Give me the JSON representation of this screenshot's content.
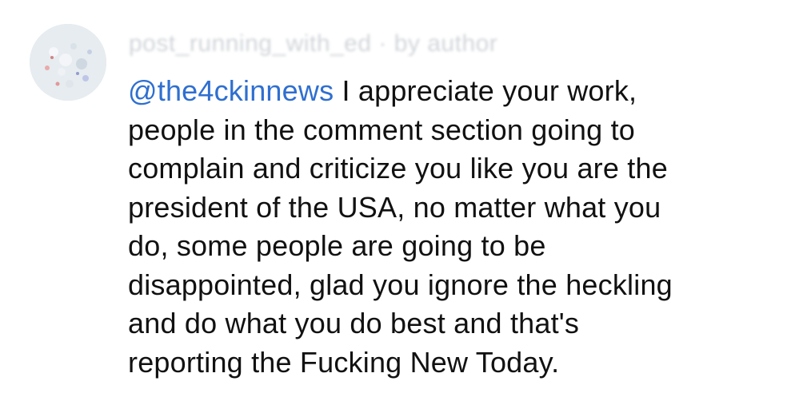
{
  "comment": {
    "username": "post_running_with_ed · by author",
    "mention": "@the4ckinnews",
    "lines": [
      " I appreciate your work,",
      "people in the comment section going to",
      "complain and criticize you like you are the",
      "president of the USA, no matter what you",
      "do, some people are going to be",
      "disappointed, glad you ignore the heckling",
      "and do what you do best and that's",
      "reporting the Fucking New Today."
    ]
  },
  "colors": {
    "mention": "#2f6fd0",
    "text": "#111111",
    "background": "#ffffff"
  },
  "icons": {
    "avatar": "avatar-image"
  }
}
